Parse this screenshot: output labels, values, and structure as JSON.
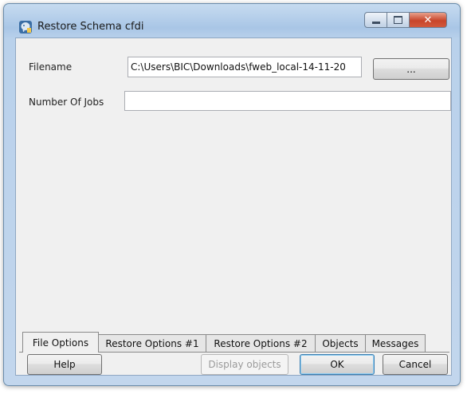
{
  "window": {
    "title": "Restore Schema cfdi",
    "close_glyph": "✕",
    "app_icon": "elephant-app-icon",
    "icons": [
      "minimize-icon",
      "maximize-icon",
      "close-icon"
    ]
  },
  "form": {
    "filename_label": "Filename",
    "filename_value": "C:\\Users\\BIC\\Downloads\\fweb_local-14-11-20",
    "browse_label": "...",
    "jobs_label": "Number Of Jobs",
    "jobs_value": ""
  },
  "tabs": [
    {
      "label": "File Options",
      "active": true
    },
    {
      "label": "Restore Options #1",
      "active": false
    },
    {
      "label": "Restore Options #2",
      "active": false
    },
    {
      "label": "Objects",
      "active": false
    },
    {
      "label": "Messages",
      "active": false
    }
  ],
  "buttons": {
    "help": "Help",
    "display_objects": "Display objects",
    "ok": "OK",
    "cancel": "Cancel"
  },
  "colors": {
    "title_bar": "#b9d1eb",
    "close_button": "#c8452a",
    "dialog_bg": "#f0f0f0"
  }
}
